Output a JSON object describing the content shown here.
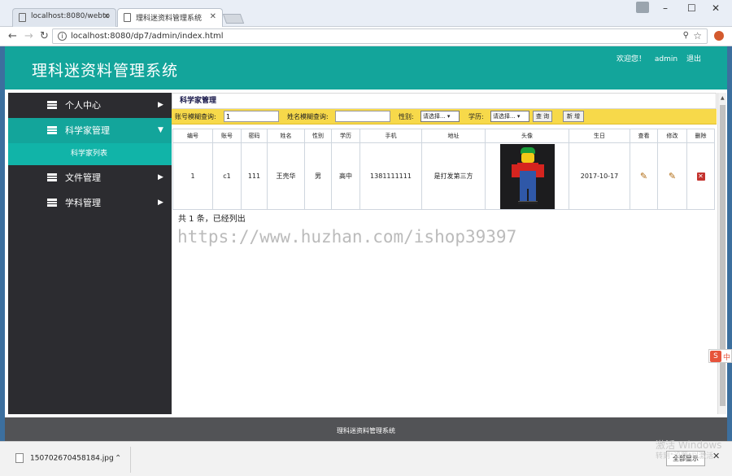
{
  "browser": {
    "tabs": [
      {
        "title": "localhost:8080/webto"
      },
      {
        "title": "理科迷资料管理系统"
      }
    ],
    "url": "localhost:8080/dp7/admin/index.html"
  },
  "header": {
    "app_title": "理科迷资料管理系统",
    "welcome": "欢迎您！",
    "username": "admin",
    "logout": "退出"
  },
  "sidebar": {
    "items": [
      {
        "label": "个人中心"
      },
      {
        "label": "科学家管理"
      },
      {
        "label": "文件管理"
      },
      {
        "label": "学科管理"
      }
    ],
    "sub_item": "科学家列表"
  },
  "main": {
    "breadcrumb": "科学家管理",
    "filters": {
      "account_label": "账号模糊查询:",
      "account_value": "1",
      "name_label": "姓名模糊查询:",
      "name_value": "",
      "gender_label": "性别:",
      "gender_value": "请选择... ▾",
      "edu_label": "学历:",
      "edu_value": "请选择... ▾",
      "query_button": "查 询",
      "add_button": "新 增"
    },
    "columns": [
      "编号",
      "账号",
      "密码",
      "姓名",
      "性别",
      "学历",
      "手机",
      "地址",
      "头像",
      "生日",
      "查看",
      "修改",
      "删除"
    ],
    "row": {
      "id": "1",
      "account": "c1",
      "password": "111",
      "name": "王壳华",
      "gender": "男",
      "education": "高中",
      "phone": "1381111111",
      "address": "是打发第三方",
      "birthday": "2017-10-17"
    },
    "total": "共 1 条，已经列出",
    "watermark": "https://www.huzhan.com/ishop39397"
  },
  "footer": {
    "text": "理科迷资料管理系统"
  },
  "ime": {
    "label": "中"
  },
  "download_shelf": {
    "filename": "150702670458184.jpg",
    "show_all": "全部显示"
  },
  "windows_activation": {
    "line1": "激活 Windows",
    "line2": "转到\"设置\"以激活"
  },
  "colors": {
    "teal": "#13a59b",
    "sidebar_dark": "#2c2c30",
    "filter_yellow": "#f7d94a",
    "footer_gray": "#525356"
  }
}
